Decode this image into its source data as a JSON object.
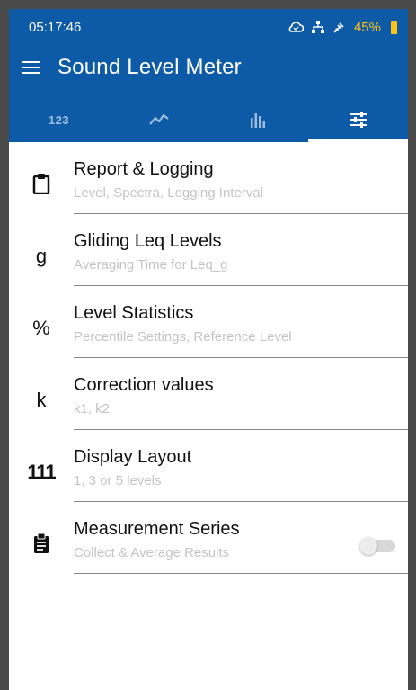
{
  "status": {
    "time": "05:17:46",
    "battery": "45%"
  },
  "app": {
    "title": "Sound Level Meter"
  },
  "tabs": [
    {
      "label": "123",
      "icon": "numeric-values"
    },
    {
      "icon": "line-chart"
    },
    {
      "icon": "spectrum-bars"
    },
    {
      "icon": "settings-sliders",
      "active": true
    }
  ],
  "items": [
    {
      "icon": "clipboard",
      "title": "Report & Logging",
      "subtitle": "Level, Spectra, Logging Interval"
    },
    {
      "icon_text": "g",
      "title": "Gliding Leq Levels",
      "subtitle": "Averaging Time for Leq_g"
    },
    {
      "icon_text": "%",
      "title": "Level Statistics",
      "subtitle": "Percentile Settings, Reference Level"
    },
    {
      "icon_text": "k",
      "title": "Correction values",
      "subtitle": "k1, k2"
    },
    {
      "icon": "display-layout",
      "icon_text": "111",
      "title": "Display Layout",
      "subtitle": "1, 3 or 5 levels"
    },
    {
      "icon": "clipboard-list",
      "title": "Measurement Series",
      "subtitle": "Collect & Average Results",
      "toggle": false
    }
  ],
  "colors": {
    "primary": "#0d5aa7",
    "battery": "#ffc21a"
  }
}
